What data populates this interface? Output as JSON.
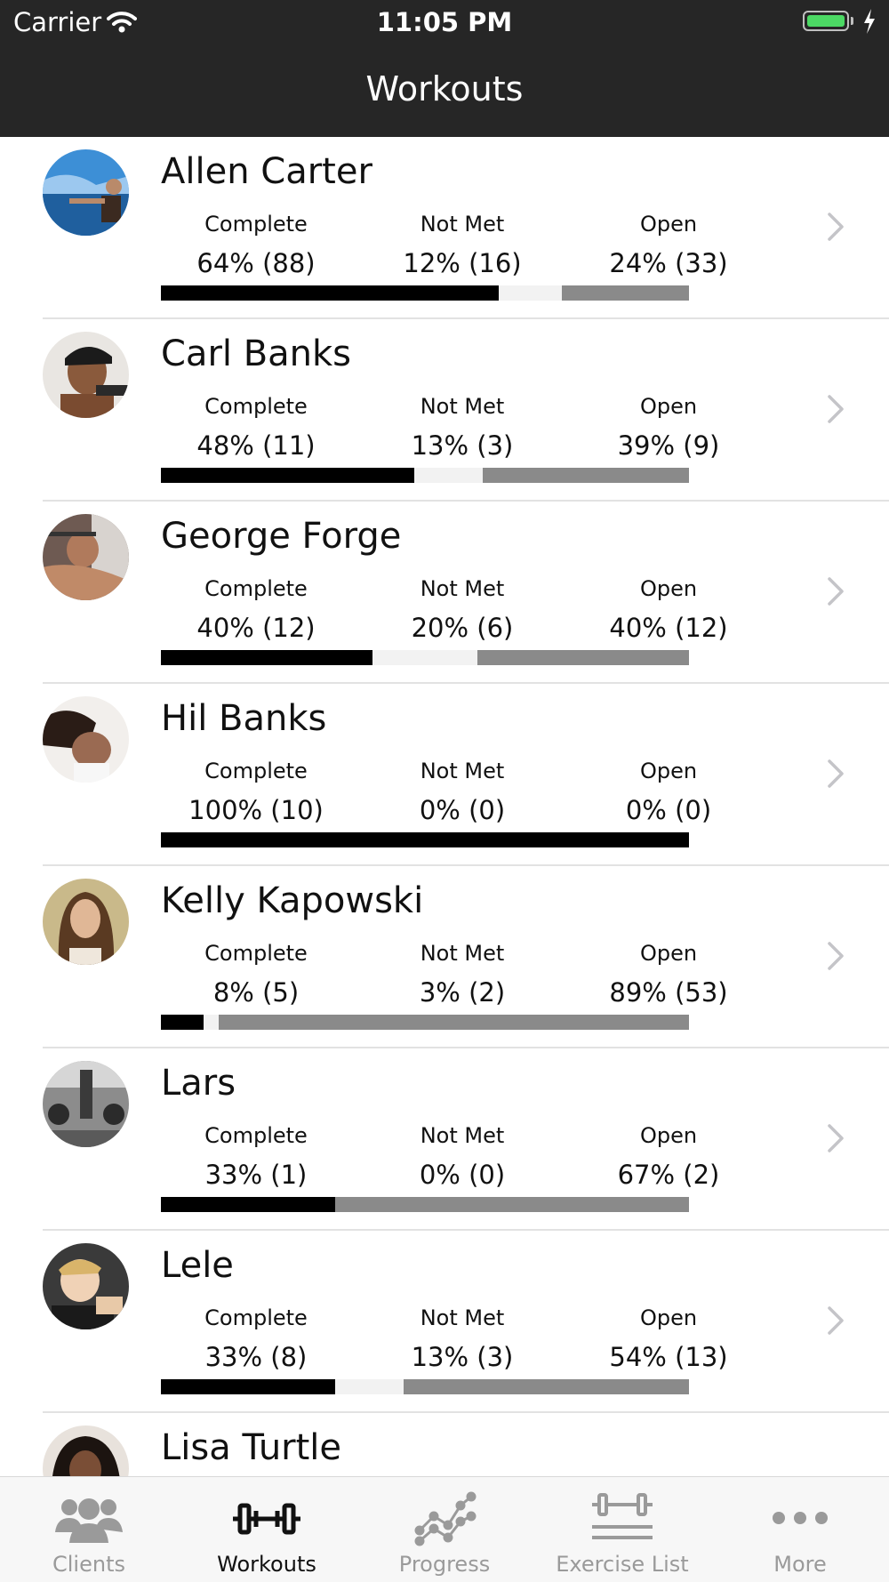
{
  "status_bar": {
    "carrier": "Carrier",
    "time": "11:05 PM"
  },
  "nav": {
    "title": "Workouts"
  },
  "colors": {
    "complete": "#000000",
    "not_met": "#f2f2f2",
    "open": "#8a8a8a",
    "header": "#262626",
    "battery": "#4cd964"
  },
  "clients": [
    {
      "name": "Allen Carter",
      "complete_label": "Complete",
      "not_met_label": "Not Met",
      "open_label": "Open",
      "complete": "64% (88)",
      "not_met": "12% (16)",
      "open": "24% (33)",
      "pct": {
        "complete": 64,
        "not_met": 12,
        "open": 24
      }
    },
    {
      "name": "Carl Banks",
      "complete_label": "Complete",
      "not_met_label": "Not Met",
      "open_label": "Open",
      "complete": "48% (11)",
      "not_met": "13% (3)",
      "open": "39% (9)",
      "pct": {
        "complete": 48,
        "not_met": 13,
        "open": 39
      }
    },
    {
      "name": "George Forge",
      "complete_label": "Complete",
      "not_met_label": "Not Met",
      "open_label": "Open",
      "complete": "40% (12)",
      "not_met": "20% (6)",
      "open": "40% (12)",
      "pct": {
        "complete": 40,
        "not_met": 20,
        "open": 40
      }
    },
    {
      "name": "Hil Banks",
      "complete_label": "Complete",
      "not_met_label": "Not Met",
      "open_label": "Open",
      "complete": "100% (10)",
      "not_met": "0% (0)",
      "open": "0% (0)",
      "pct": {
        "complete": 100,
        "not_met": 0,
        "open": 0
      }
    },
    {
      "name": "Kelly Kapowski",
      "complete_label": "Complete",
      "not_met_label": "Not Met",
      "open_label": "Open",
      "complete": "8% (5)",
      "not_met": "3% (2)",
      "open": "89% (53)",
      "pct": {
        "complete": 8,
        "not_met": 3,
        "open": 89
      }
    },
    {
      "name": "Lars",
      "complete_label": "Complete",
      "not_met_label": "Not Met",
      "open_label": "Open",
      "complete": "33% (1)",
      "not_met": "0% (0)",
      "open": "67% (2)",
      "pct": {
        "complete": 33,
        "not_met": 0,
        "open": 67
      }
    },
    {
      "name": "Lele",
      "complete_label": "Complete",
      "not_met_label": "Not Met",
      "open_label": "Open",
      "complete": "33% (8)",
      "not_met": "13% (3)",
      "open": "54% (13)",
      "pct": {
        "complete": 33,
        "not_met": 13,
        "open": 54
      }
    },
    {
      "name": "Lisa Turtle"
    }
  ],
  "tab_bar": {
    "items": [
      {
        "label": "Clients",
        "icon": "clients-icon"
      },
      {
        "label": "Workouts",
        "icon": "dumbbell-icon",
        "active": true
      },
      {
        "label": "Progress",
        "icon": "progress-chart-icon"
      },
      {
        "label": "Exercise List",
        "icon": "exercise-list-icon"
      },
      {
        "label": "More",
        "icon": "more-icon"
      }
    ]
  }
}
